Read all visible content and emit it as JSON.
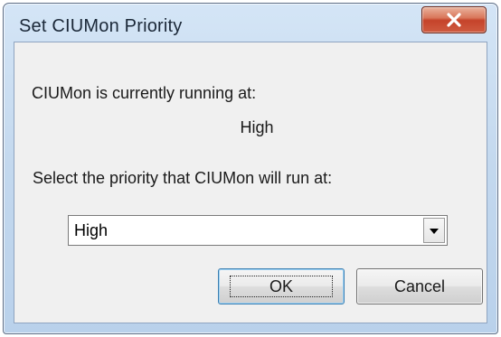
{
  "window": {
    "title": "Set CIUMon Priority"
  },
  "icons": {
    "close": "close-icon",
    "dropdown_arrow": "chevron-down-icon"
  },
  "colors": {
    "close_button": "#c5432a",
    "title_bar": "#c3d8ee",
    "client_background": "#f0f0f0"
  },
  "content": {
    "current_label": "CIUMon is currently running at:",
    "current_value": "High",
    "select_label": "Select the priority that CIUMon will run at:"
  },
  "priority_select": {
    "selected": "High"
  },
  "buttons": {
    "ok_label": "OK",
    "cancel_label": "Cancel"
  }
}
